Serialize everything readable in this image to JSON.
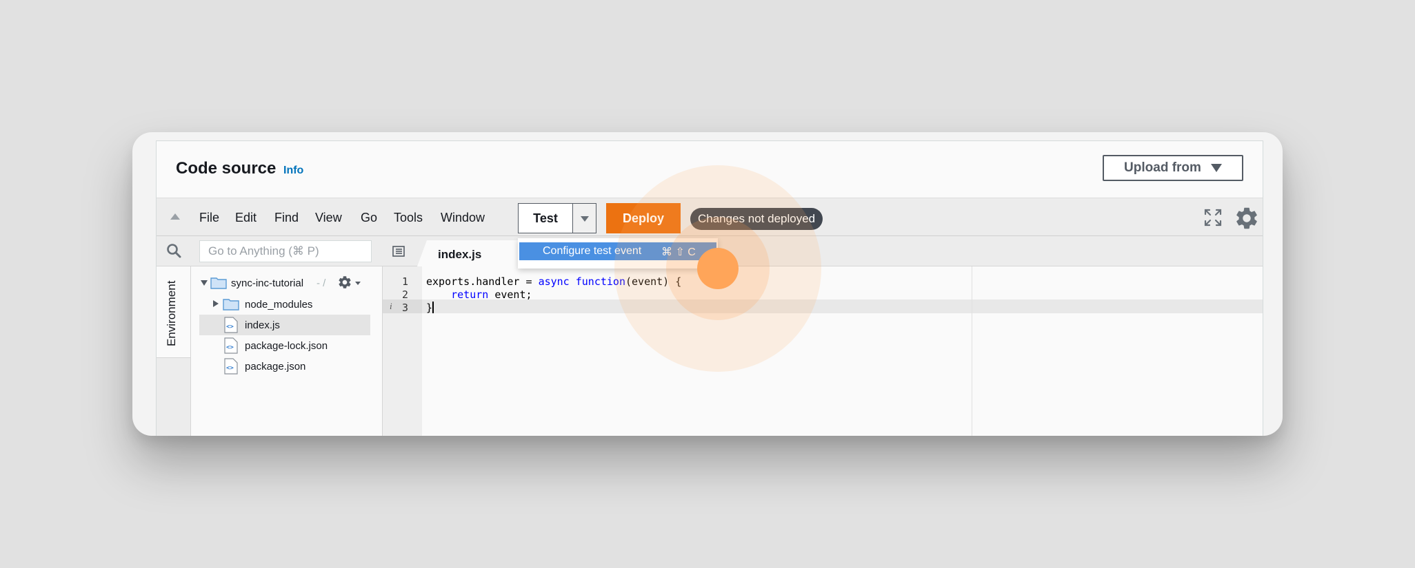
{
  "header": {
    "title": "Code source",
    "info_link": "Info",
    "upload_button": "Upload from"
  },
  "menubar": {
    "items": [
      "File",
      "Edit",
      "Find",
      "View",
      "Go",
      "Tools",
      "Window"
    ],
    "test_button": "Test",
    "deploy_button": "Deploy",
    "status_badge": "Changes not deployed"
  },
  "dropdown": {
    "item_label": "Configure test event",
    "item_shortcut": "⌘ ⇧ C"
  },
  "sidebar": {
    "search_placeholder": "Go to Anything (⌘ P)",
    "env_tab": "Environment",
    "root_folder": "sync-inc-tutorial",
    "root_suffix": " - /",
    "items": [
      {
        "label": "node_modules",
        "type": "folder"
      },
      {
        "label": "index.js",
        "type": "file"
      },
      {
        "label": "package-lock.json",
        "type": "file"
      },
      {
        "label": "package.json",
        "type": "file"
      }
    ]
  },
  "editor": {
    "tab": "index.js",
    "line_numbers": [
      "1",
      "2",
      "3"
    ],
    "lines": [
      {
        "before": "exports.handler = ",
        "kw": "async function",
        "after": "(event) {"
      },
      {
        "before": "    ",
        "kw": "return",
        "after": " event;"
      },
      {
        "before": "}",
        "kw": "",
        "after": ""
      }
    ]
  },
  "colors": {
    "deploy": "#ec7211",
    "badge": "#414750",
    "link": "#0073bb",
    "dropdown_highlight": "#4a90e2",
    "click_highlight": "#ffa559"
  }
}
